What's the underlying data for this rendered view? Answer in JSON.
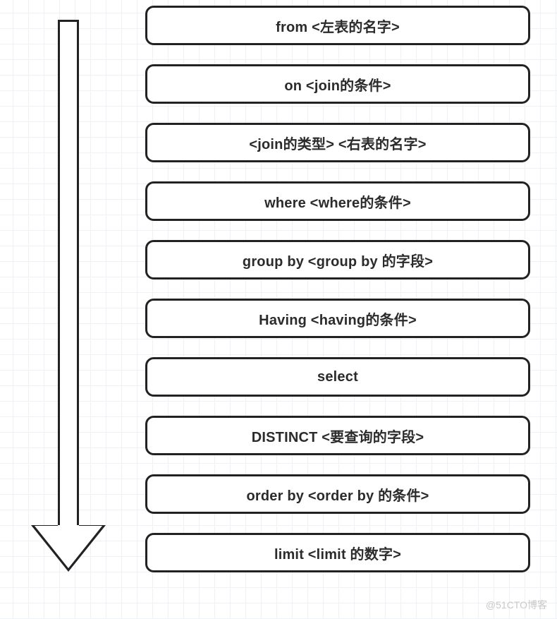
{
  "steps": [
    "from  <左表的名字>",
    "on <join的条件>",
    "<join的类型> <右表的名字>",
    "where <where的条件>",
    "group by <group by 的字段>",
    "Having <having的条件>",
    "select",
    "DISTINCT <要查询的字段>",
    "order by <order by 的条件>",
    "limit <limit 的数字>"
  ],
  "watermark": "@51CTO博客"
}
